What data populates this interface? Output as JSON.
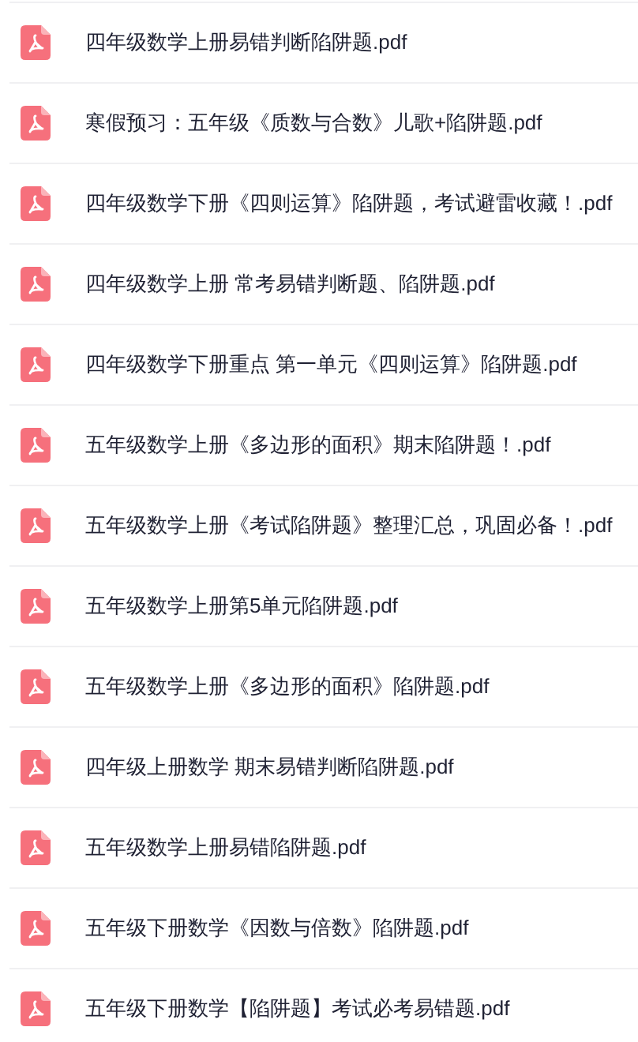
{
  "files": [
    {
      "name": "四年级数学上册易错判断陷阱题.pdf"
    },
    {
      "name": "寒假预习：五年级《质数与合数》儿歌+陷阱题.pdf"
    },
    {
      "name": "四年级数学下册《四则运算》陷阱题，考试避雷收藏！.pdf"
    },
    {
      "name": "四年级数学上册 常考易错判断题、陷阱题.pdf"
    },
    {
      "name": "四年级数学下册重点 第一单元《四则运算》陷阱题.pdf"
    },
    {
      "name": "五年级数学上册《多边形的面积》期末陷阱题！.pdf"
    },
    {
      "name": "五年级数学上册《考试陷阱题》整理汇总，巩固必备！.pdf"
    },
    {
      "name": "五年级数学上册第5单元陷阱题.pdf"
    },
    {
      "name": "五年级数学上册《多边形的面积》陷阱题.pdf"
    },
    {
      "name": "四年级上册数学 期末易错判断陷阱题.pdf"
    },
    {
      "name": "五年级数学上册易错陷阱题.pdf"
    },
    {
      "name": "五年级下册数学《因数与倍数》陷阱题.pdf"
    },
    {
      "name": "五年级下册数学【陷阱题】考试必考易错题.pdf"
    }
  ]
}
